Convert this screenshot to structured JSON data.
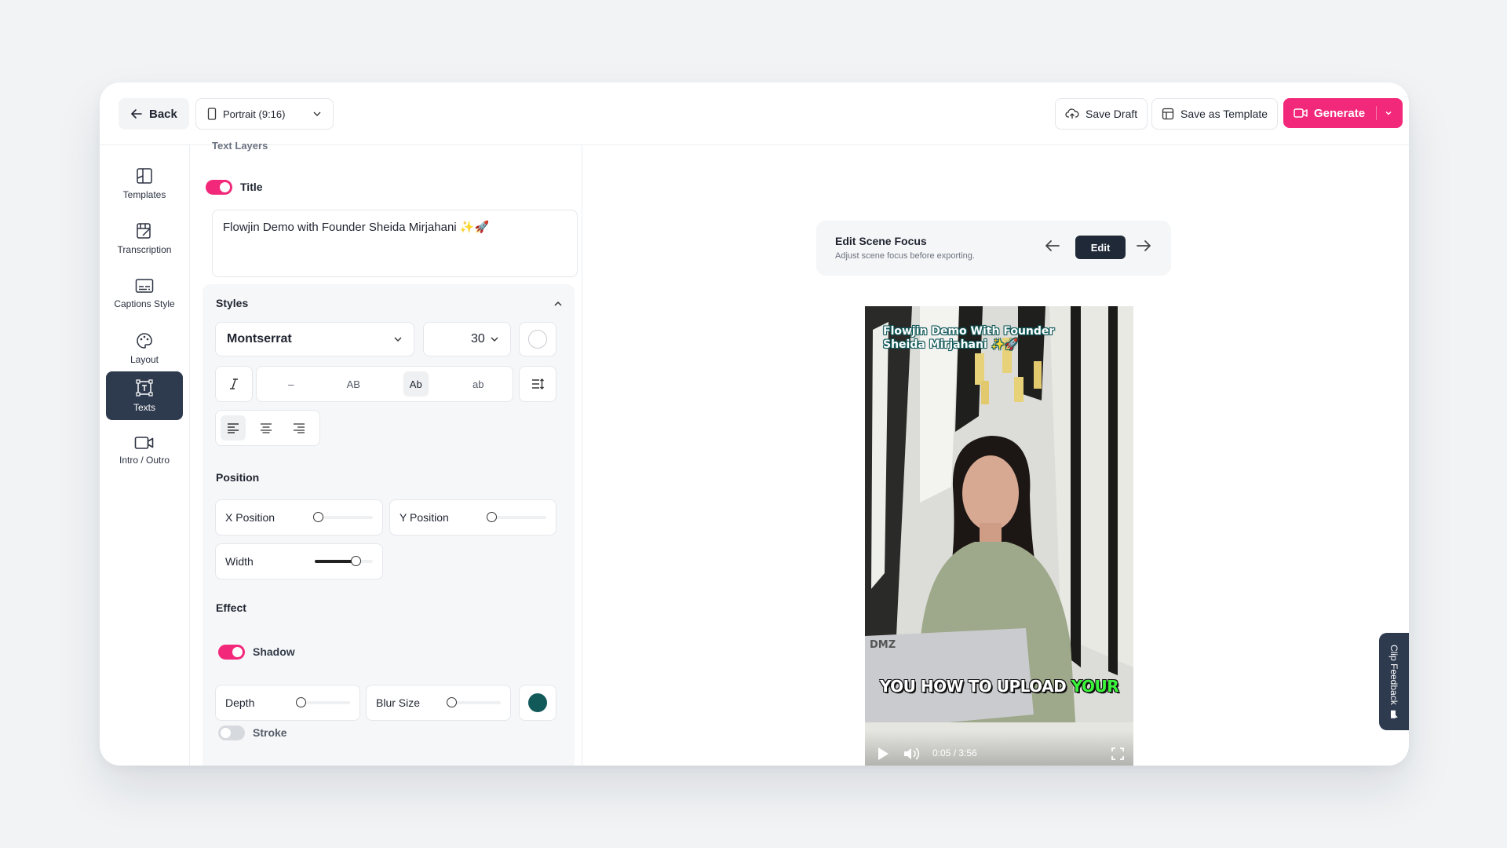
{
  "topbar": {
    "back_label": "Back",
    "aspect_ratio": "Portrait (9:16)",
    "save_draft_label": "Save Draft",
    "save_template_label": "Save as Template",
    "generate_label": "Generate"
  },
  "nav": {
    "items": [
      {
        "label": "Templates",
        "icon": "templates-icon"
      },
      {
        "label": "Transcription",
        "icon": "transcription-icon"
      },
      {
        "label": "Captions Style",
        "icon": "captions-icon"
      },
      {
        "label": "Layout",
        "icon": "palette-icon"
      },
      {
        "label": "Texts",
        "icon": "text-icon",
        "active": true
      },
      {
        "label": "Intro / Outro",
        "icon": "video-icon"
      }
    ]
  },
  "panel": {
    "section_heading": "Text Layers",
    "title_toggle_label": "Title",
    "title_toggle_on": true,
    "title_value": "Flowjin Demo with Founder Sheida Mirjahani ✨🚀",
    "styles_heading": "Styles",
    "font_family": "Montserrat",
    "font_size": "30",
    "case_options": [
      "–",
      "AB",
      "Ab",
      "ab"
    ],
    "case_selected": "Ab",
    "position_heading": "Position",
    "x_position_label": "X Position",
    "x_position_value": 0.05,
    "y_position_label": "Y Position",
    "y_position_value": 0.05,
    "width_label": "Width",
    "width_value": 0.7,
    "effect_heading": "Effect",
    "shadow_label": "Shadow",
    "shadow_on": true,
    "depth_label": "Depth",
    "depth_value": 0.05,
    "blur_label": "Blur Size",
    "blur_value": 0.05,
    "shadow_color": "#12595a",
    "stroke_label": "Stroke",
    "stroke_on": false
  },
  "preview": {
    "scene_focus_title": "Edit Scene Focus",
    "scene_focus_subtitle": "Adjust scene focus before exporting.",
    "edit_label": "Edit",
    "overlay_title": "Flowjin Demo With Founder Sheida Mirjahani ✨🚀",
    "caption_prefix": "YOU HOW TO UPLOAD",
    "caption_highlight": "YOUR",
    "time": "0:05 / 3:56",
    "progress": 0.02
  },
  "feedback_label": "Clip Feedback",
  "colors": {
    "accent": "#f2287a",
    "nav_active": "#2e3a4e",
    "caption_highlight": "#3bf53b"
  }
}
